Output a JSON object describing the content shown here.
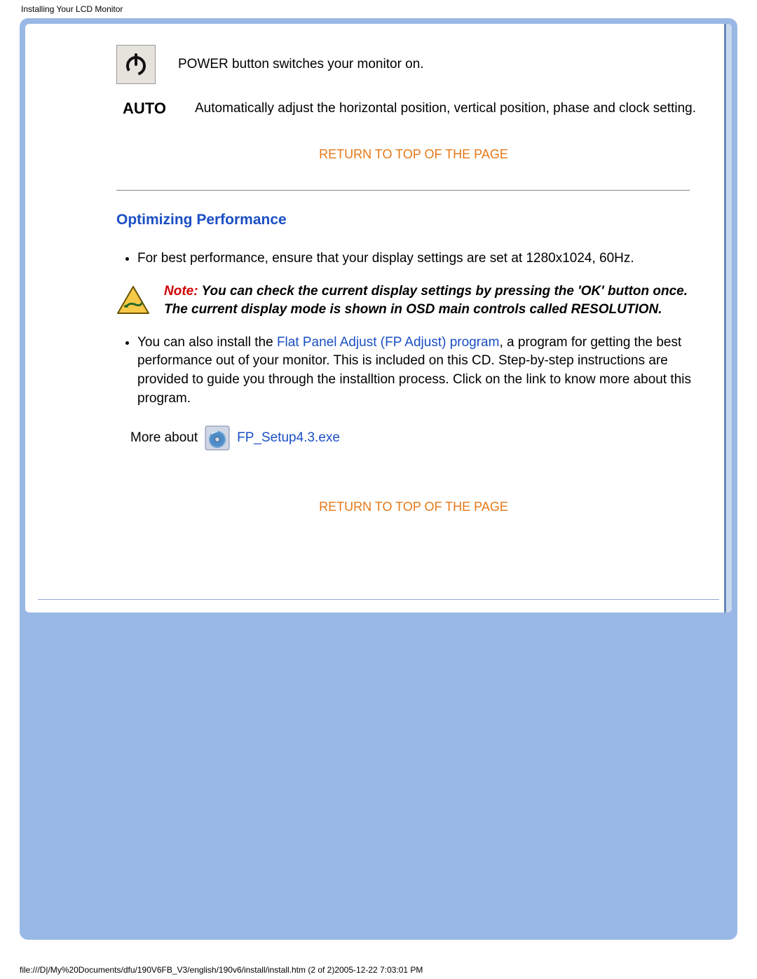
{
  "document_title": "Installing Your LCD Monitor",
  "buttons": {
    "power": {
      "label": "POWER",
      "description": "POWER button switches your monitor on."
    },
    "auto": {
      "label": "AUTO",
      "description": "Automatically adjust the horizontal position, vertical position, phase and clock setting."
    }
  },
  "links": {
    "return_top": "RETURN TO TOP OF THE PAGE",
    "fp_program": "Flat Panel Adjust (FP Adjust) program",
    "fp_setup": "FP_Setup4.3.exe"
  },
  "section": {
    "title": "Optimizing Performance",
    "bullet1": "For best performance, ensure that your display settings are set at 1280x1024, 60Hz.",
    "note_prefix": "Note:",
    "note_body": " You can check the current display settings by pressing the 'OK' button once. The current display mode is shown in OSD main controls called RESOLUTION.",
    "bullet2_before": "You can also install the ",
    "bullet2_after": ", a program for getting the best performance out of your monitor. This is included on this CD. Step-by-step instructions are provided to guide you through the installtion process. Click on the link to know more about this program.",
    "more_about": "More about"
  },
  "footer": "file:///D|/My%20Documents/dfu/190V6FB_V3/english/190v6/install/install.htm (2 of 2)2005-12-22 7:03:01 PM"
}
